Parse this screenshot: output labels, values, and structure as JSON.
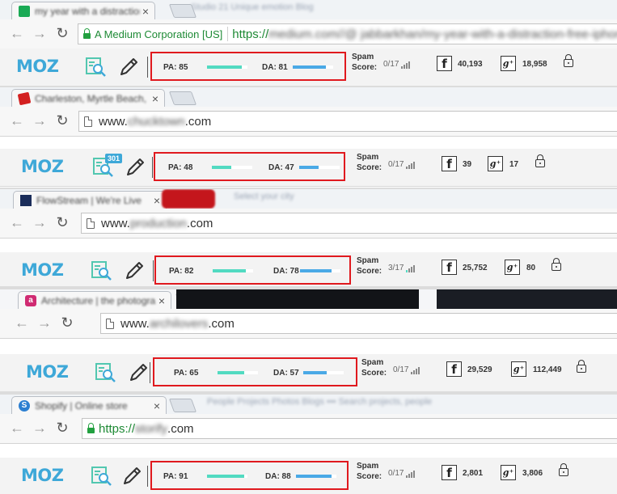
{
  "colors": {
    "moz_blue": "#3ea8d8",
    "pa_bar": "#52dac1",
    "da_bar": "#4aa9e6",
    "highlight_box": "#e0191e",
    "ev_green": "#1e8a35"
  },
  "panels": [
    {
      "tab": {
        "title": "my year with a distraction",
        "favicon": "medium-icon",
        "close": "×"
      },
      "bg_tabs": "Studio 21   Unique emotion Blog",
      "address": {
        "ev_label": "A Medium Corporation [US]",
        "scheme": "https://",
        "host": "medium.com/",
        "rest": "/@ jabbarkhan/my-year-with-a-distraction-free-iphone"
      },
      "moz": {
        "logo": "MOZ",
        "pa_label": "PA: 85",
        "pa": 85,
        "da_label": "DA: 81",
        "da": 81,
        "spam_label": "Spam\nScore:",
        "spam_label_1": "Spam",
        "spam_label_2": "Score:",
        "spam_value": "0/17",
        "fb_count": "40,193",
        "gplus_count": "18,958",
        "redirect_badge": ""
      }
    },
    {
      "tab": {
        "title": "Charleston, Myrtle Beach, ...",
        "favicon": "red-flag-icon",
        "close": "×"
      },
      "bg_tabs": "",
      "address": {
        "ev_label": "",
        "scheme": "www.",
        "host": "chucktown",
        "rest": ".com"
      },
      "moz": {
        "logo": "MOZ",
        "pa_label": "PA: 48",
        "pa": 48,
        "da_label": "DA: 47",
        "da": 47,
        "spam_label_1": "Spam",
        "spam_label_2": "Score:",
        "spam_value": "0/17",
        "fb_count": "39",
        "gplus_count": "17",
        "redirect_badge": "301"
      }
    },
    {
      "tab": {
        "title": "FlowStream | We're Live",
        "favicon": "bar-chart-favicon",
        "close": "×"
      },
      "bg_tabs": "Select your city",
      "address": {
        "ev_label": "",
        "scheme": "www.",
        "host": "production",
        "rest": ".com"
      },
      "moz": {
        "logo": "MOZ",
        "pa_label": "PA: 82",
        "pa": 82,
        "da_label": "DA: 78",
        "da": 78,
        "spam_label_1": "Spam",
        "spam_label_2": "Score:",
        "spam_value": "3/17",
        "fb_count": "25,752",
        "gplus_count": "80",
        "redirect_badge": ""
      }
    },
    {
      "tab": {
        "title": "Architecture | the photography",
        "favicon": "letter-a-icon",
        "close": "×"
      },
      "bg_tabs": "",
      "address": {
        "ev_label": "",
        "scheme": "www.",
        "host": "archilovers",
        "rest": ".com"
      },
      "moz": {
        "logo": "MOZ",
        "pa_label": "PA: 65",
        "pa": 65,
        "da_label": "DA: 57",
        "da": 57,
        "spam_label_1": "Spam",
        "spam_label_2": "Score:",
        "spam_value": "0/17",
        "fb_count": "29,529",
        "gplus_count": "112,449",
        "redirect_badge": ""
      }
    },
    {
      "tab": {
        "title": "Shopify | Online store",
        "favicon": "blue-circle-icon",
        "close": "×"
      },
      "bg_tabs": "People   Projects   Photos   Blogs   •••   Search projects, people",
      "address": {
        "ev_label": "",
        "scheme": "https://",
        "host": "storify",
        "rest": ".com"
      },
      "moz": {
        "logo": "MOZ",
        "pa_label": "PA: 91",
        "pa": 91,
        "da_label": "DA: 88",
        "da": 88,
        "spam_label_1": "Spam",
        "spam_label_2": "Score:",
        "spam_value": "0/17",
        "fb_count": "2,801",
        "gplus_count": "3,806",
        "redirect_badge": ""
      }
    }
  ],
  "icons": {
    "back": "arrow-left-icon",
    "forward": "arrow-right-icon",
    "reload": "reload-icon",
    "analyze": "page-analysis-icon",
    "highlighter": "pencil-icon",
    "facebook": "facebook-icon",
    "gplus": "google-plus-icon",
    "lock": "padlock-icon"
  },
  "glyphs": {
    "back": "←",
    "forward": "→",
    "reload": "↻",
    "fb": "f",
    "gp": "g⁺"
  }
}
